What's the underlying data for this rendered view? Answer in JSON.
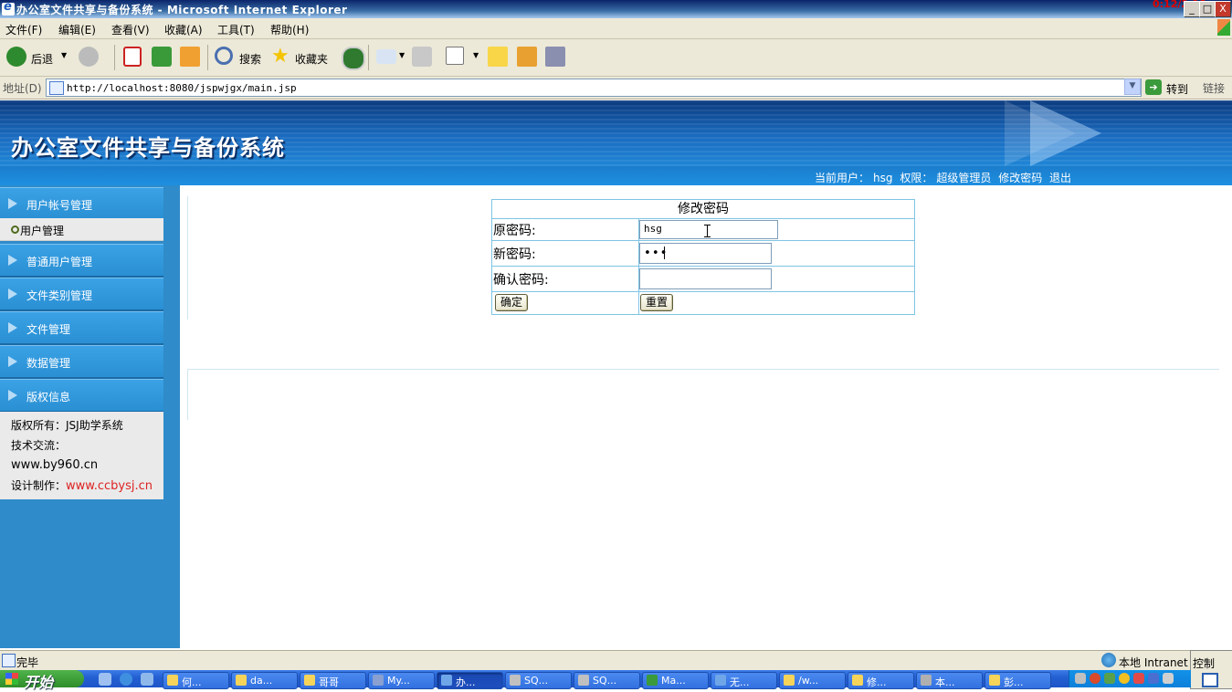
{
  "window": {
    "title": "办公室文件共享与备份系统 - Microsoft Internet Explorer",
    "clock": "0:12/2:18",
    "buttons": {
      "minimize": "_",
      "maximize": "□",
      "close": "X"
    }
  },
  "menu": [
    "文件(F)",
    "编辑(E)",
    "查看(V)",
    "收藏(A)",
    "工具(T)",
    "帮助(H)"
  ],
  "toolbar": {
    "back": "后退",
    "search": "搜索",
    "favorites": "收藏夹"
  },
  "address": {
    "label": "地址(D)",
    "url": "http://localhost:8080/jspwjgx/main.jsp",
    "go": "转到",
    "links": "链接"
  },
  "header": {
    "site_title": "办公室文件共享与备份系统",
    "current_user_label": "当前用户：",
    "current_user": "hsg",
    "role_label": "权限：",
    "role": "超级管理员",
    "change_password": "修改密码",
    "logout": "退出"
  },
  "sidebar": {
    "items": [
      {
        "label": "用户帐号管理"
      },
      {
        "label": "普通用户管理"
      },
      {
        "label": "文件类别管理"
      },
      {
        "label": "文件管理"
      },
      {
        "label": "数据管理"
      },
      {
        "label": "版权信息"
      }
    ],
    "subitem": "用户管理",
    "copyright": {
      "owner": "版权所有：JSJ助学系统",
      "tech": "技术交流：",
      "site": "www.by960.cn",
      "design_label": "设计制作：",
      "design_site": "www.ccbysj.cn"
    }
  },
  "form": {
    "title": "修改密码",
    "old_label": "原密码:",
    "old_value": "hsg",
    "new_label": "新密码:",
    "new_value": "•••",
    "confirm_label": "确认密码:",
    "confirm_value": "",
    "submit": "确定",
    "reset": "重置"
  },
  "status": {
    "text": "完毕",
    "zone": "本地 Intranet",
    "control_panel": "控制"
  },
  "taskbar": {
    "start": "开始",
    "tasks": [
      "何...",
      "da...",
      "哥哥",
      "My...",
      "办...",
      "SQ...",
      "SQ...",
      "Ma...",
      "无...",
      "/w...",
      "修...",
      "本...",
      "彭..."
    ]
  }
}
